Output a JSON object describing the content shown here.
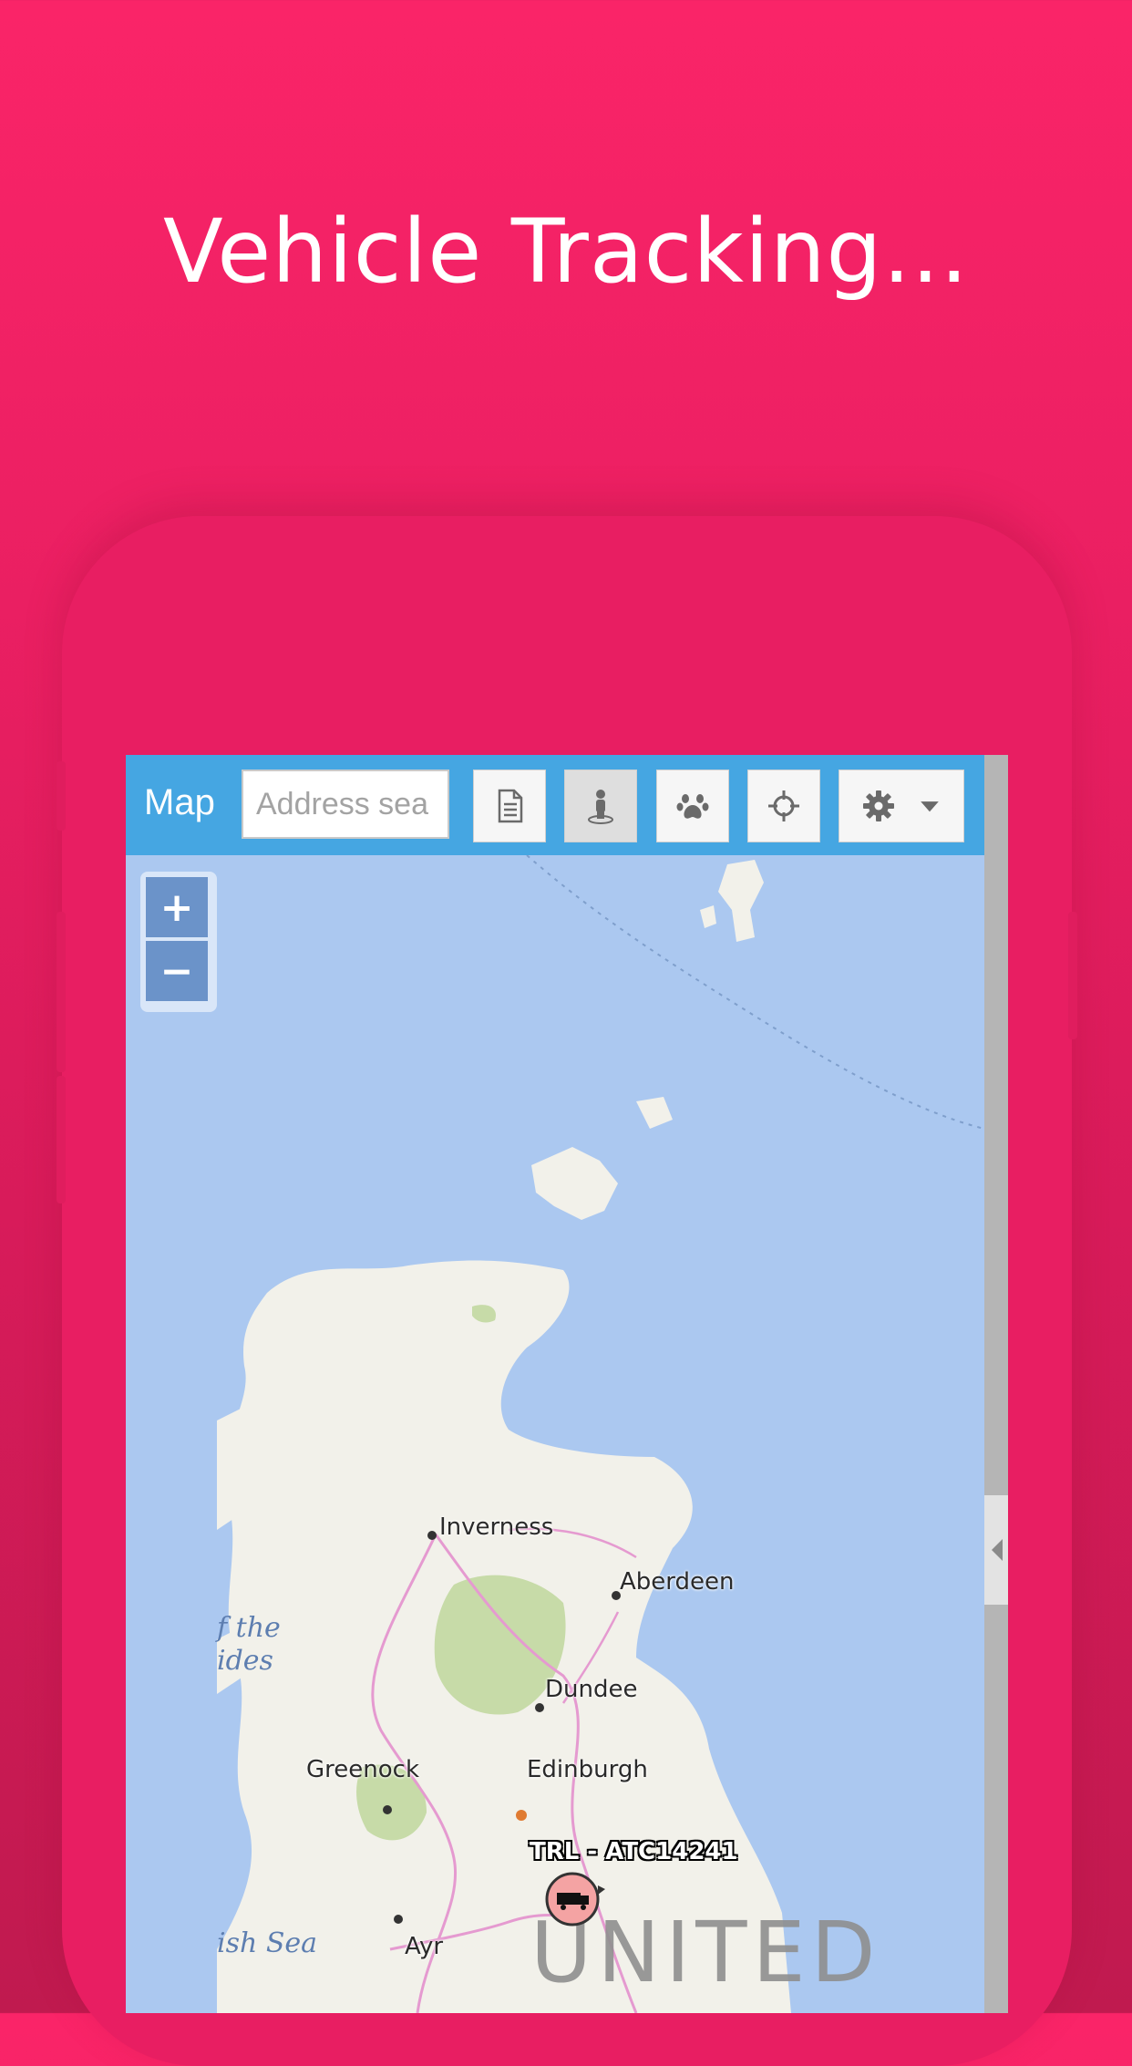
{
  "headline": "Vehicle Tracking...",
  "toolbar": {
    "title": "Map",
    "address_placeholder": "Address sea",
    "buttons": [
      "document-icon",
      "person-icon",
      "paw-icon",
      "crosshair-icon",
      "gear-icon"
    ]
  },
  "zoom": {
    "in_label": "+",
    "out_label": "−"
  },
  "map": {
    "cities": [
      "Inverness",
      "Aberdeen",
      "Dundee",
      "Greenock",
      "Edinburgh",
      "Ayr"
    ],
    "sea_labels": [
      "f the",
      "ides",
      "ish Sea"
    ],
    "country_label": "UNITED",
    "vehicle_label": "TRL - ATC14241"
  },
  "colors": {
    "background": "#fa2468",
    "toolbar": "#45a6e2",
    "sea": "#abc8f0",
    "land": "#f2f1ea",
    "vehicle_marker": "#f4a3a3"
  }
}
